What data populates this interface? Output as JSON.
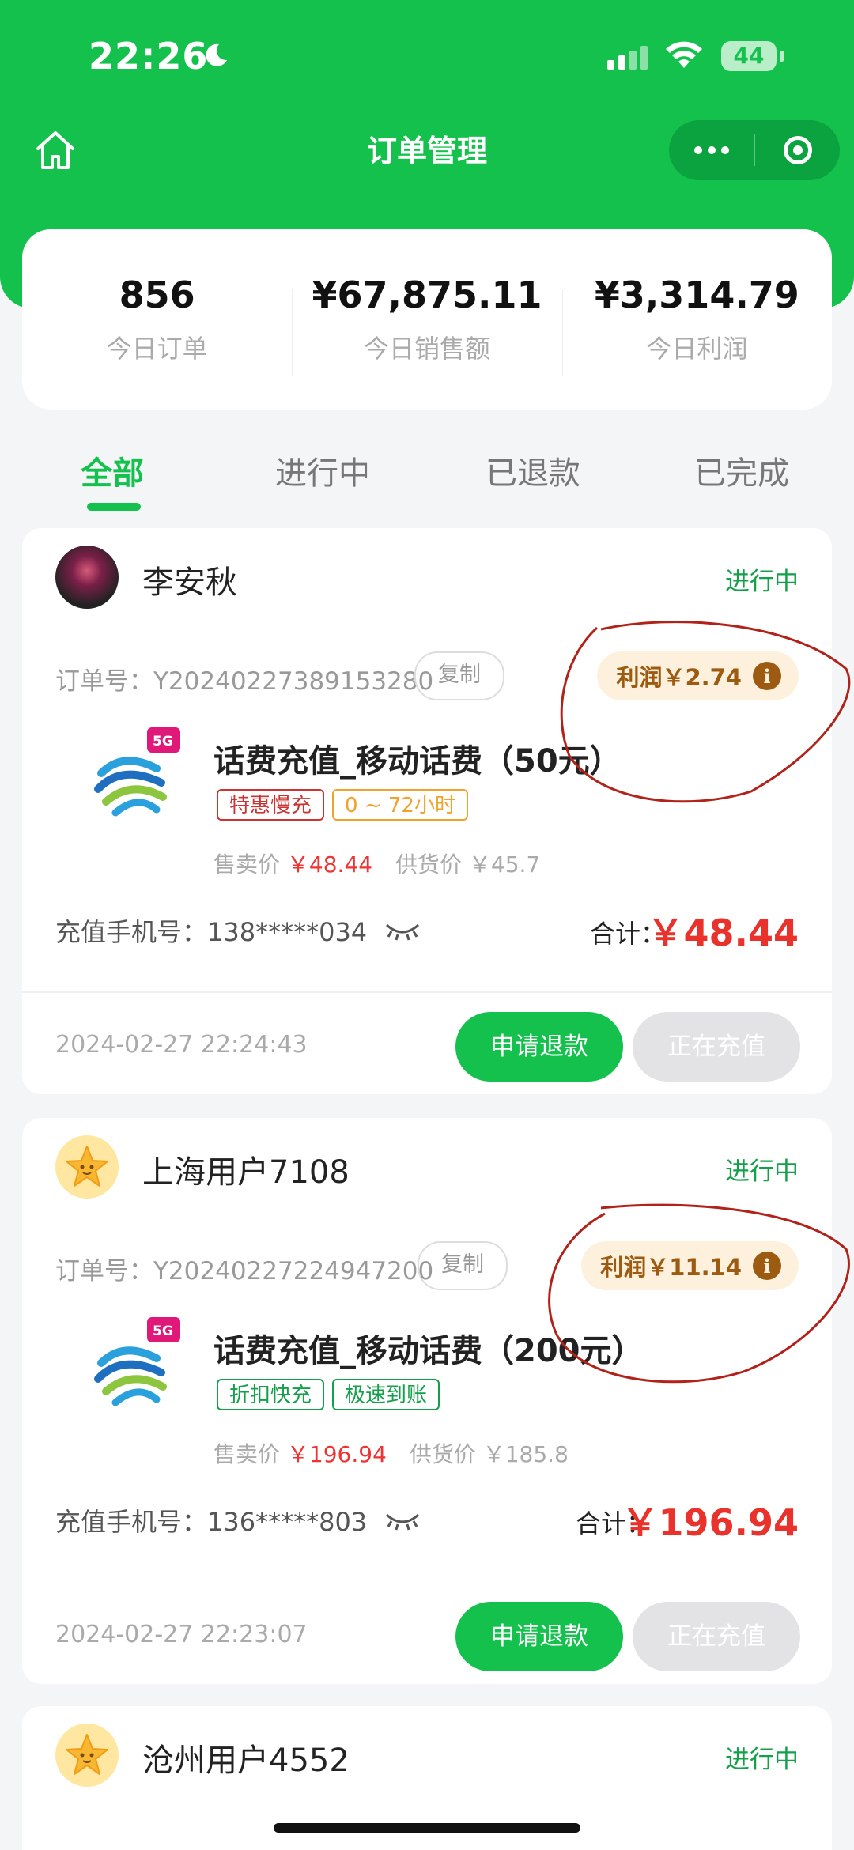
{
  "status_bar": {
    "time": "22:26",
    "battery": "44"
  },
  "header": {
    "title": "订单管理"
  },
  "colors": {
    "brand_green": "#14c14d",
    "price_red": "#e8322b",
    "profit_brown": "#9c5b10"
  },
  "stats": [
    {
      "value": "856",
      "label": "今日订单"
    },
    {
      "value": "¥67,875.11",
      "label": "今日销售额"
    },
    {
      "value": "¥3,314.79",
      "label": "今日利润"
    }
  ],
  "tabs": [
    {
      "label": "全部",
      "active": true
    },
    {
      "label": "进行中",
      "active": false
    },
    {
      "label": "已退款",
      "active": false
    },
    {
      "label": "已完成",
      "active": false
    }
  ],
  "orders": [
    {
      "user": "李安秋",
      "status": "进行中",
      "order_label": "订单号：",
      "order_no": "Y20240227389153280",
      "copy": "复制",
      "profit": "利润￥2.74",
      "product": "话费充值_移动话费（50元）",
      "tags": [
        "特惠慢充",
        "0 ~ 72小时"
      ],
      "sell_label": "售卖价",
      "sell_price": "￥48.44",
      "supply_label": "供货价",
      "supply_price": "￥45.7",
      "phone": "充值手机号：138*****034",
      "total_label": "合计：",
      "total": "￥48.44",
      "datetime": "2024-02-27 22:24:43",
      "refund_btn": "申请退款",
      "charging_btn": "正在充值"
    },
    {
      "user": "上海用户7108",
      "status": "进行中",
      "order_label": "订单号：",
      "order_no": "Y20240227224947200",
      "copy": "复制",
      "profit": "利润￥11.14",
      "product": "话费充值_移动话费（200元）",
      "tags": [
        "折扣快充",
        "极速到账"
      ],
      "sell_label": "售卖价",
      "sell_price": "￥196.94",
      "supply_label": "供货价",
      "supply_price": "￥185.8",
      "phone": "充值手机号：136*****803",
      "total_label": "合计：",
      "total": "￥196.94",
      "datetime": "2024-02-27 22:23:07",
      "refund_btn": "申请退款",
      "charging_btn": "正在充值"
    },
    {
      "user": "沧州用户4552",
      "status": "进行中"
    }
  ]
}
